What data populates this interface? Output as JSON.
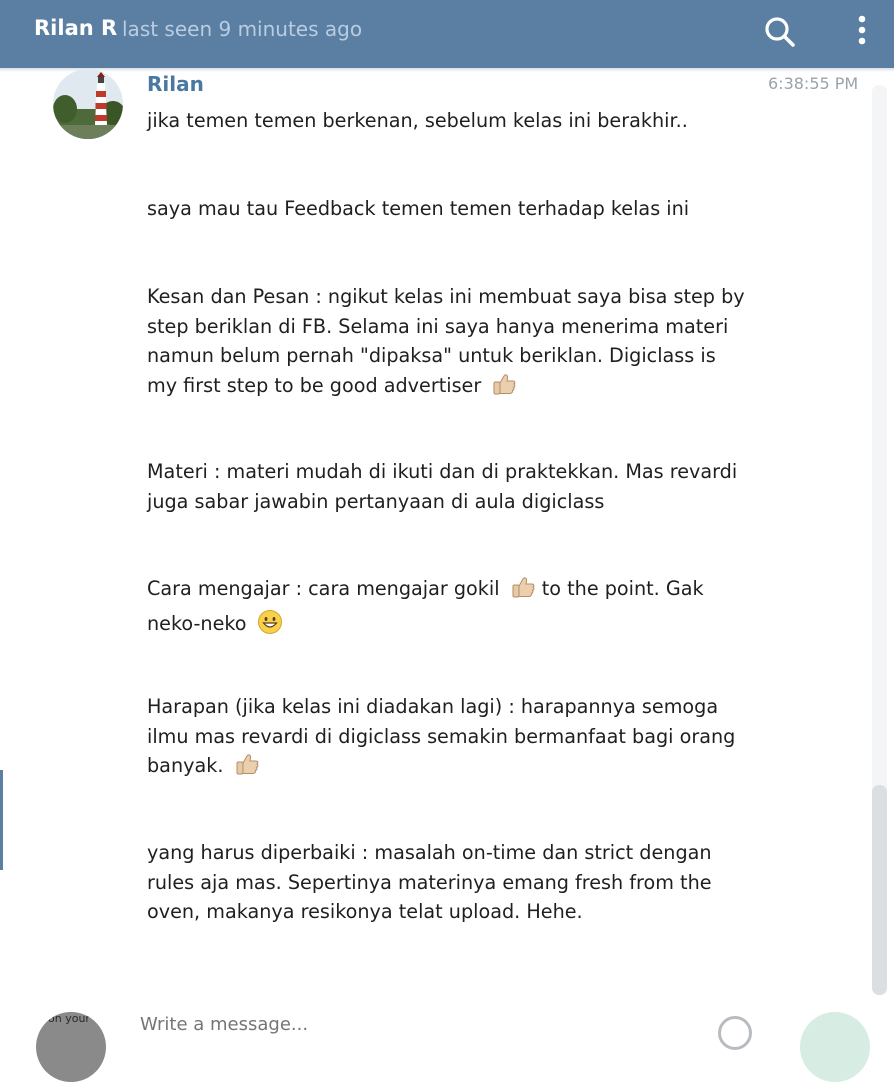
{
  "header": {
    "name": "Rilan R",
    "status": "last seen 9 minutes ago",
    "search_icon": "search-icon",
    "menu_icon": "vertical-dots-icon",
    "color": "#5b7ea3"
  },
  "message": {
    "sender": "Rilan",
    "time": "6:38:55 PM",
    "avatar_icon": "lighthouse-avatar",
    "paragraphs": [
      "jika temen temen berkenan, sebelum kelas ini berakhir..",
      "saya mau tau Feedback temen temen terhadap kelas ini",
      "Kesan dan Pesan : ngikut kelas ini membuat saya bisa step by step beriklan di FB. Selama ini saya hanya menerima materi namun belum pernah \"dipaksa\" untuk beriklan. Digiclass is my first step to be good advertiser",
      "Materi : materi mudah di ikuti dan di praktekkan. Mas revardi juga sabar jawabin pertanyaan di aula digiclass",
      "Cara mengajar : cara mengajar gokil",
      "to the point. Gak neko-neko",
      "Harapan (jika kelas ini diadakan lagi) : harapannya semoga ilmu mas revardi di digiclass semakin bermanfaat bagi orang banyak.",
      "yang harus diperbaiki : masalah on-time dan strict dengan rules aja mas. Sepertinya materinya emang fresh from the oven, makanya resikonya telat upload. Hehe."
    ],
    "emojis": [
      "thumbs-up-emoji",
      "thumbs-up-emoji",
      "grinning-face-emoji",
      "thumbs-up-emoji"
    ]
  },
  "composer": {
    "placeholder": "Write a message...",
    "bottom_avatar_text": "on your",
    "emoji_icon": "emoji-smile-icon"
  }
}
